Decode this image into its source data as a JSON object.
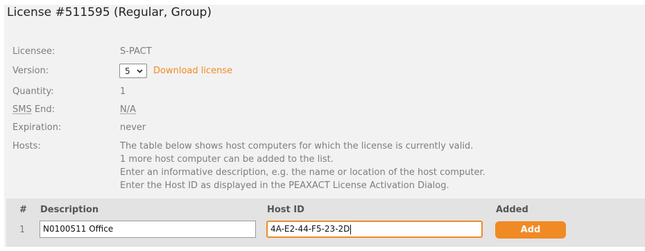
{
  "title": "License #511595 (Regular, Group)",
  "details": {
    "licensee": {
      "label": "Licensee:",
      "value": "S-PACT"
    },
    "version": {
      "label": "Version:",
      "selected": "5",
      "download_link": "Download license"
    },
    "quantity": {
      "label": "Quantity:",
      "value": "1"
    },
    "sms_end": {
      "label_abbr": "SMS",
      "label_rest": " End:",
      "value": "N/A"
    },
    "expiration": {
      "label": "Expiration:",
      "value": "never"
    },
    "hosts": {
      "label": "Hosts:",
      "lines": [
        "The table below shows host computers for which the license is currently valid.",
        "1 more host computer can be added to the list.",
        "Enter an informative description, e.g. the name or location of the host computer.",
        "Enter the Host ID as displayed in the PEAXACT License Activation Dialog."
      ]
    }
  },
  "table": {
    "headers": {
      "num": "#",
      "description": "Description",
      "host_id": "Host ID",
      "added": "Added"
    },
    "row": {
      "num": "1",
      "description": "N0100511 Office",
      "host_id": "4A-E2-44-F5-23-2D"
    },
    "add_button": "Add"
  },
  "colors": {
    "accent": "#f08a24",
    "panel": "#f2f2f2",
    "table_bg": "#e3e3e3",
    "muted_text": "#7d7d7d"
  },
  "icons": {
    "version_select": "chevron-down-icon"
  }
}
